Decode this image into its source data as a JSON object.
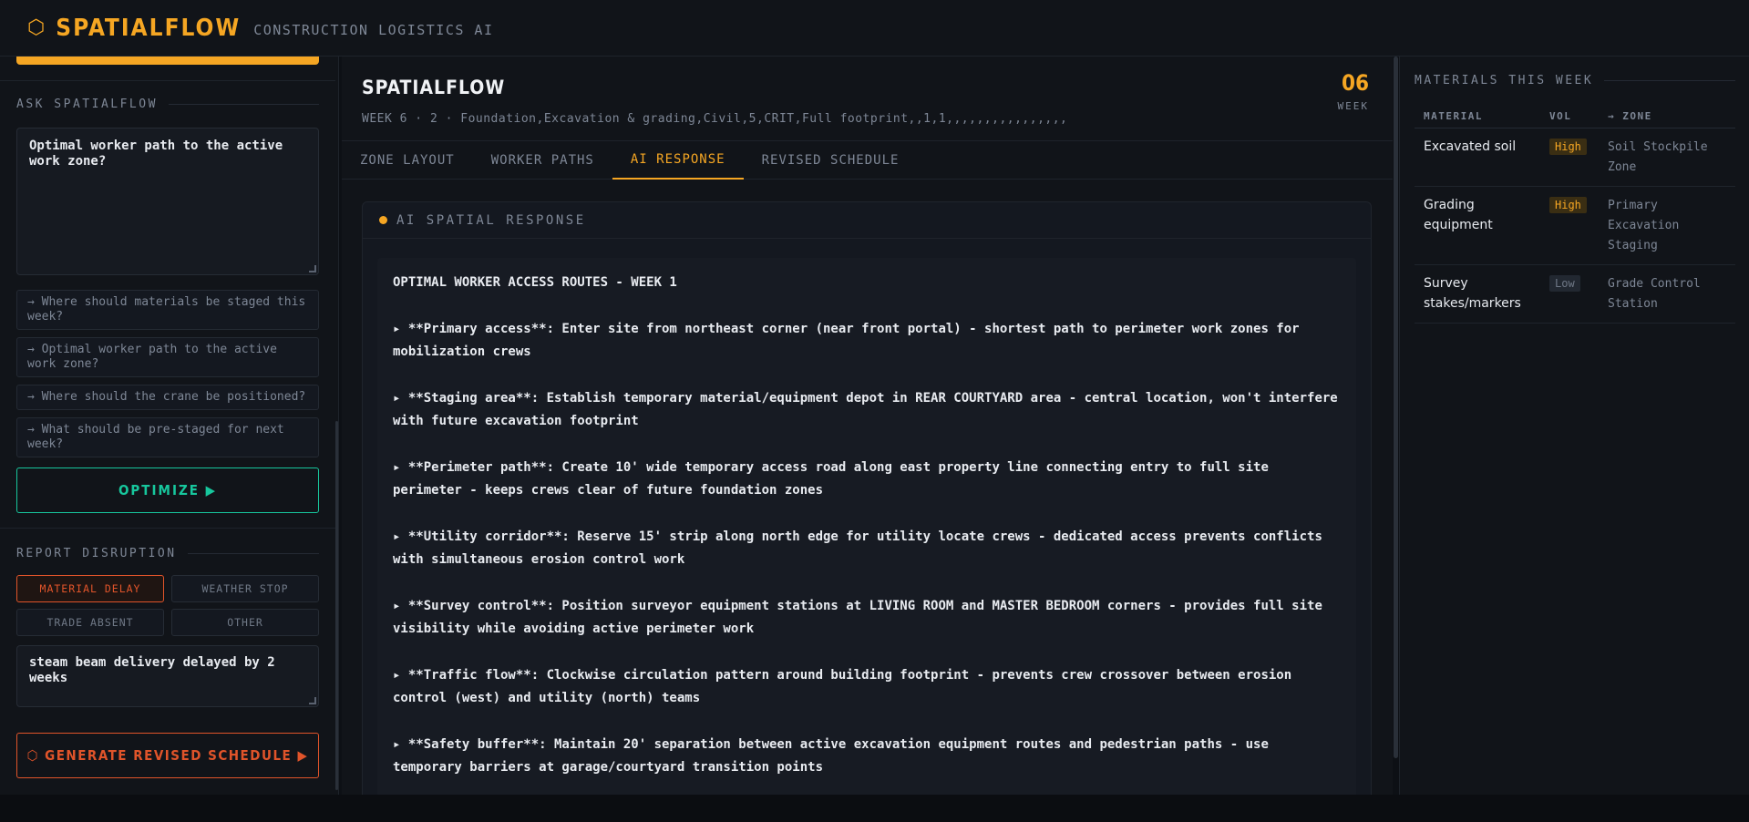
{
  "header": {
    "logo_icon": "⬡",
    "title": "SPATIALFLOW",
    "subtitle": "CONSTRUCTION LOGISTICS AI"
  },
  "sidebar": {
    "ask_label": "ASK SPATIALFLOW",
    "ask_value": "Optimal worker path to the active work zone?",
    "suggestions": [
      "→ Where should materials be staged this week?",
      "→ Optimal worker path to the active work zone?",
      "→ Where should the crane be positioned?",
      "→ What should be pre-staged for next week?"
    ],
    "optimize_label": "OPTIMIZE ▶",
    "report_label": "REPORT DISRUPTION",
    "disruption_buttons": [
      "MATERIAL DELAY",
      "WEATHER STOP",
      "TRADE ABSENT",
      "OTHER"
    ],
    "disruption_value": "steam beam delivery delayed by 2 weeks",
    "generate_label": "⬡ GENERATE REVISED SCHEDULE ▶"
  },
  "main": {
    "title": "SPATIALFLOW",
    "subtitle": "WEEK 6 · 2 · Foundation,Excavation & grading,Civil,5,CRIT,Full footprint,,1,1,,,,,,,,,,,,,,,,",
    "week_number": "06",
    "week_label": "WEEK",
    "tabs": [
      "ZONE LAYOUT",
      "WORKER PATHS",
      "AI RESPONSE",
      "REVISED SCHEDULE"
    ],
    "active_tab": 2,
    "response_header": "AI SPATIAL RESPONSE",
    "response_title": "OPTIMAL WORKER ACCESS ROUTES - WEEK 1",
    "response_items": [
      "▸ **Primary access**: Enter site from northeast corner (near front portal) - shortest path to perimeter work zones for mobilization crews",
      "▸ **Staging area**: Establish temporary material/equipment depot in REAR COURTYARD area - central location, won't interfere with future excavation footprint",
      "▸ **Perimeter path**: Create 10' wide temporary access road along east property line connecting entry to full site perimeter - keeps crews clear of future foundation zones",
      "▸ **Utility corridor**: Reserve 15' strip along north edge for utility locate crews - dedicated access prevents conflicts with simultaneous erosion control work",
      "▸ **Survey control**: Position surveyor equipment stations at LIVING ROOM and MASTER BEDROOM corners - provides full site visibility while avoiding active perimeter work",
      "▸ **Traffic flow**: Clockwise circulation pattern around building footprint - prevents crew crossover between erosion control (west) and utility (north) teams",
      "▸ **Safety buffer**: Maintain 20' separation between active excavation equipment routes and pedestrian paths - use temporary barriers at garage/courtyard transition points"
    ]
  },
  "materials": {
    "label": "MATERIALS THIS WEEK",
    "columns": [
      "MATERIAL",
      "VOL",
      "→ ZONE"
    ],
    "rows": [
      {
        "material": "Excavated soil",
        "vol": "High",
        "zone": "Soil Stockpile Zone"
      },
      {
        "material": "Grading equipment",
        "vol": "High",
        "zone": "Primary Excavation Staging"
      },
      {
        "material": "Survey stakes/markers",
        "vol": "Low",
        "zone": "Grade Control Station"
      }
    ]
  },
  "colors": {
    "accent": "#f5a623",
    "optimize": "#17c79d",
    "disruption": "#e0542a",
    "background": "#111419"
  }
}
